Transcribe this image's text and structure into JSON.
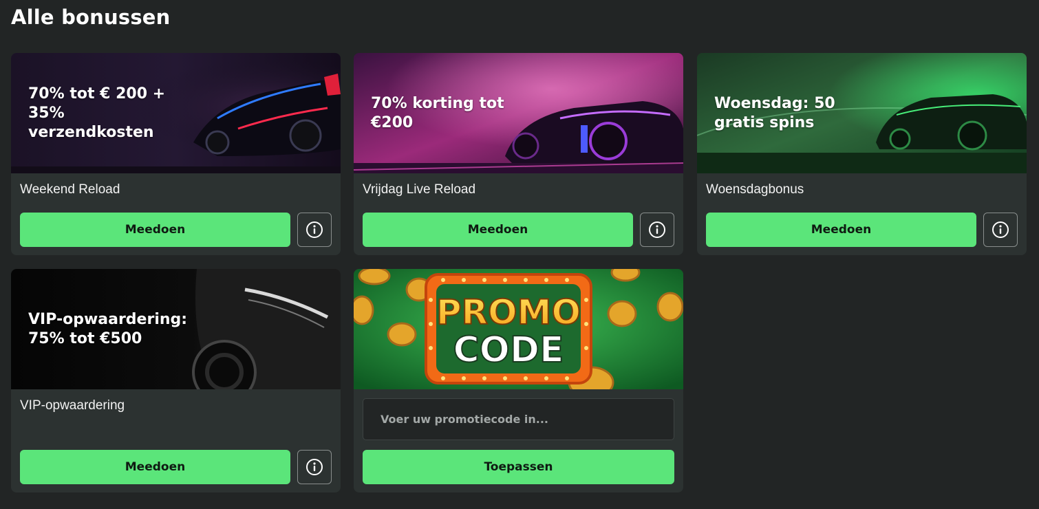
{
  "page": {
    "title": "Alle bonussen"
  },
  "colors": {
    "background": "#222525",
    "card": "#2c3231",
    "accent": "#5be57a",
    "button_text": "#0f1a12"
  },
  "bonuses": [
    {
      "banner_text": "70% tot € 200 + 35% verzendkosten",
      "name": "Weekend Reload",
      "button_label": "Meedoen",
      "info_icon": "info-circle-icon"
    },
    {
      "banner_text": "70% korting tot €200",
      "name": "Vrijdag Live Reload",
      "button_label": "Meedoen",
      "info_icon": "info-circle-icon"
    },
    {
      "banner_text": "Woensdag: 50 gratis spins",
      "name": "Woensdagbonus",
      "button_label": "Meedoen",
      "info_icon": "info-circle-icon"
    },
    {
      "banner_text": "VIP-opwaardering: 75% tot €500",
      "name": "VIP-opwaardering",
      "button_label": "Meedoen",
      "info_icon": "info-circle-icon"
    }
  ],
  "promo": {
    "banner_line1": "PROMO",
    "banner_line2": "CODE",
    "input_placeholder": "Voer uw promotiecode in...",
    "apply_label": "Toepassen"
  }
}
